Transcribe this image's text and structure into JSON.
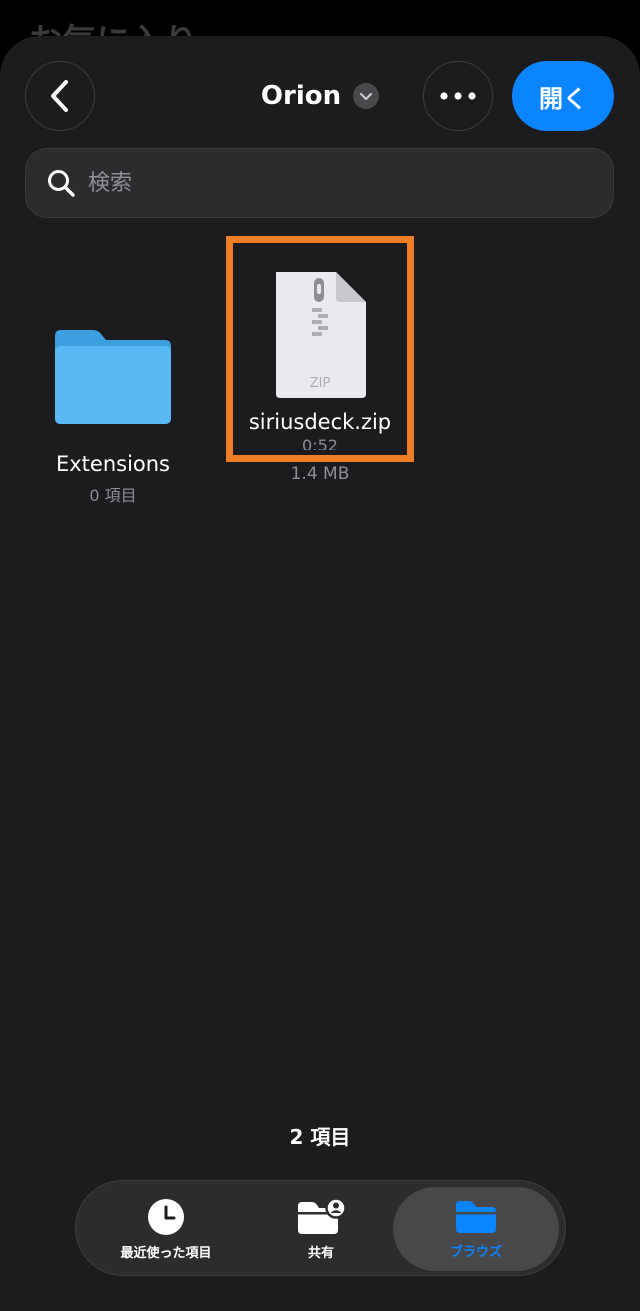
{
  "background": {
    "title": "お気に入り"
  },
  "header": {
    "title": "Orion",
    "open_label": "開く"
  },
  "search": {
    "placeholder": "検索"
  },
  "items": [
    {
      "name": "Extensions",
      "subtitle": "0 項目"
    },
    {
      "name": "siriusdeck.zip",
      "subtitle": "0:52",
      "size": "1.4 MB",
      "badge": "ZIP"
    }
  ],
  "footer": {
    "count": "2 項目"
  },
  "tabbar": {
    "tabs": [
      {
        "label": "最近使った項目",
        "icon": "clock-icon"
      },
      {
        "label": "共有",
        "icon": "shared-folder-icon"
      },
      {
        "label": "ブラウズ",
        "icon": "folder-icon",
        "selected": true
      }
    ]
  },
  "colors": {
    "accent": "#0a84ff",
    "highlight": "#f07e26",
    "sheet": "#1c1c1e"
  }
}
